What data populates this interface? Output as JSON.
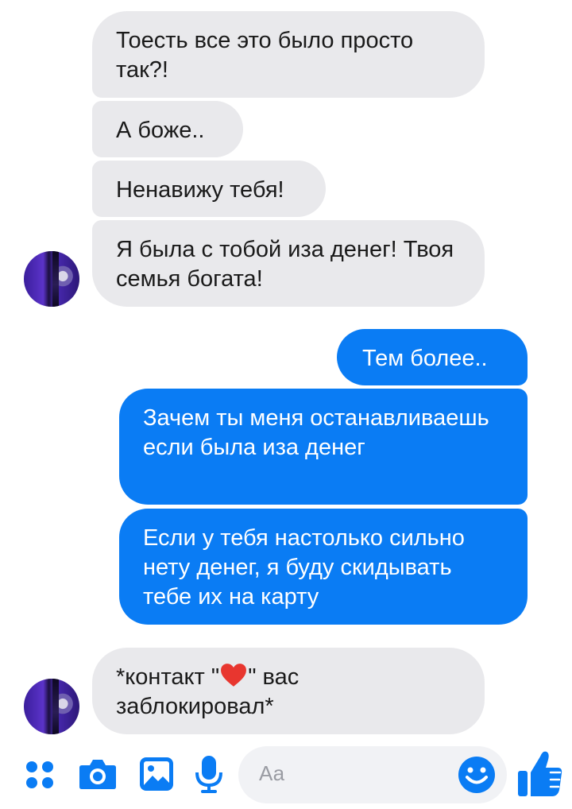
{
  "messages": [
    {
      "side": "in",
      "text": "Тоесть все это было просто так?!"
    },
    {
      "side": "in",
      "text": "А боже.."
    },
    {
      "side": "in",
      "text": "Ненавижу тебя!"
    },
    {
      "side": "in",
      "text": "Я была с тобой иза денег! Твоя семья богата!"
    },
    {
      "side": "out",
      "text": "Тем более.."
    },
    {
      "side": "out",
      "text": "Зачем ты меня останавливаешь если была иза денег"
    },
    {
      "side": "out",
      "text": "Если у тебя настолько сильно нету денег, я буду скидывать тебе их на карту"
    },
    {
      "side": "in",
      "text_before": "*контакт \"",
      "text_after": "\" вас заблокировал*",
      "emoji": "red-heart"
    }
  ],
  "composer": {
    "placeholder": "Аа",
    "icons": [
      "apps-icon",
      "camera-icon",
      "gallery-icon",
      "microphone-icon",
      "emoji-icon",
      "thumbs-up-icon"
    ]
  },
  "colors": {
    "accent": "#0a7cf4",
    "incoming_bubble": "#e9e9ec",
    "outgoing_bubble": "#0a7cf4",
    "heart": "#e8362f"
  }
}
